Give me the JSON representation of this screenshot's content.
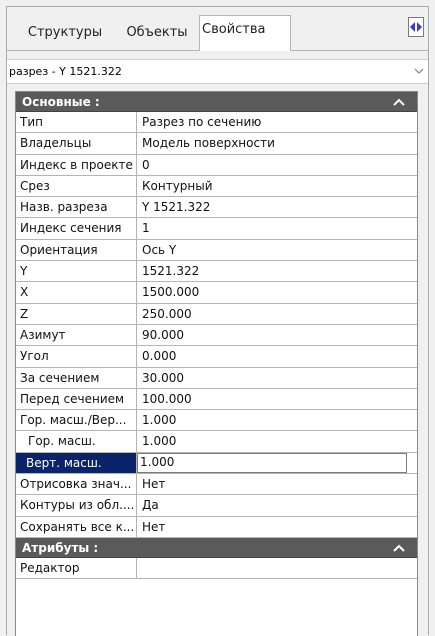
{
  "tabs": [
    {
      "label": "Структуры"
    },
    {
      "label": "Объекты"
    },
    {
      "label": "Свойства"
    }
  ],
  "combo": {
    "value": "разрез - Y 1521.322"
  },
  "sections": [
    {
      "title": "Основные :",
      "rows": [
        {
          "key": "Тип",
          "value": "Разрез по сечению"
        },
        {
          "key": "Владельцы",
          "value": "Модель поверхности"
        },
        {
          "key": "Индекс в проекте",
          "value": "0"
        },
        {
          "key": "Срез",
          "value": "Контурный"
        },
        {
          "key": "Назв. разреза",
          "value": "Y 1521.322"
        },
        {
          "key": "Индекс сечения",
          "value": "1"
        },
        {
          "key": "Ориентация",
          "value": "Ось Y"
        },
        {
          "key": "Y",
          "value": "1521.322"
        },
        {
          "key": "X",
          "value": "1500.000"
        },
        {
          "key": "Z",
          "value": "250.000"
        },
        {
          "key": "Азимут",
          "value": "90.000"
        },
        {
          "key": "Угол",
          "value": "0.000"
        },
        {
          "key": "За сечением",
          "value": "30.000"
        },
        {
          "key": "Перед сечением",
          "value": "100.000"
        },
        {
          "key": "Гор. масш./Вер...",
          "value": "1.000"
        },
        {
          "key": "Гор. масш.",
          "value": "1.000"
        },
        {
          "key": "Верт. масш.",
          "value": "1.000"
        },
        {
          "key": "Отрисовка знач...",
          "value": "Нет"
        },
        {
          "key": "Контуры из обл....",
          "value": "Да"
        },
        {
          "key": "Сохранять все к...",
          "value": "Нет"
        }
      ]
    },
    {
      "title": "Атрибуты :",
      "rows": [
        {
          "key": "Редактор",
          "value": ""
        }
      ]
    }
  ]
}
